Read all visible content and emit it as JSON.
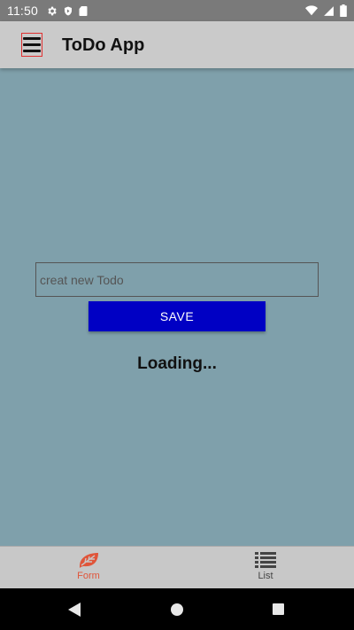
{
  "status_bar": {
    "time": "11:50",
    "icons_left": [
      "gear-icon",
      "shield-icon",
      "sd-card-icon"
    ],
    "icons_right": [
      "wifi-icon",
      "signal-icon",
      "battery-icon"
    ]
  },
  "app_bar": {
    "title": "ToDo App",
    "menu_icon": "menu-icon"
  },
  "form": {
    "input_placeholder": "creat new Todo",
    "input_value": "",
    "save_label": "SAVE",
    "save_color": "#0000c4",
    "loading_text": "Loading..."
  },
  "bottom_tabs": {
    "items": [
      {
        "label": "Form",
        "icon": "leaf-icon",
        "active": true
      },
      {
        "label": "List",
        "icon": "list-icon",
        "active": false
      }
    ],
    "active_color": "#e0553a"
  },
  "nav_bar": {
    "icons": [
      "back-icon",
      "home-icon",
      "recents-icon"
    ]
  },
  "colors": {
    "background": "#7fa0ab",
    "app_bar": "#cacaca",
    "tab_bar": "#c8c8c8"
  }
}
